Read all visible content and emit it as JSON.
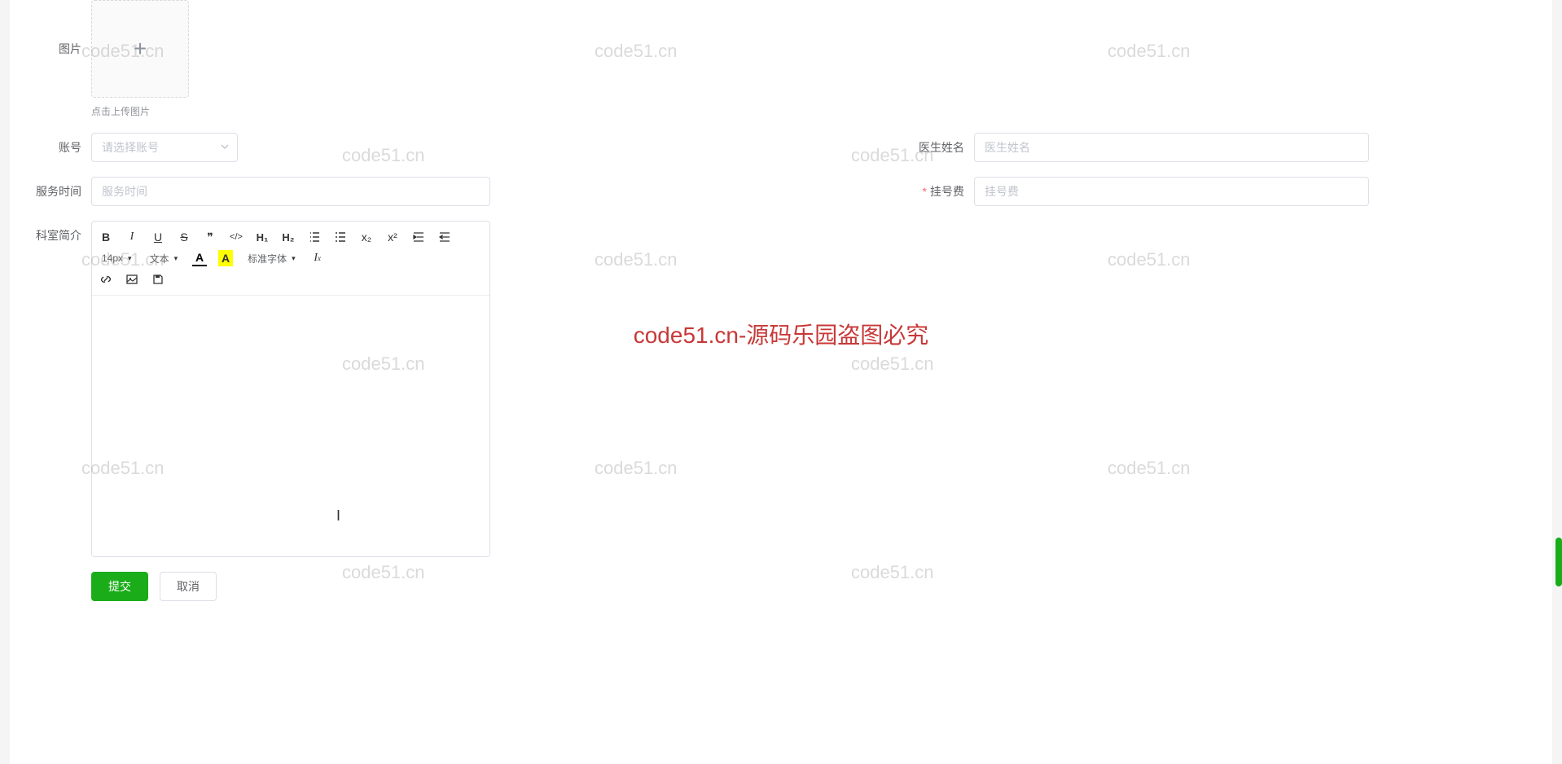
{
  "labels": {
    "image": "图片",
    "upload_hint": "点击上传图片",
    "account": "账号",
    "doctor_name": "医生姓名",
    "service_time": "服务时间",
    "registration_fee": "挂号费",
    "department_intro": "科室简介"
  },
  "placeholders": {
    "account": "请选择账号",
    "doctor_name": "医生姓名",
    "service_time": "服务时间",
    "registration_fee": "挂号费"
  },
  "editor": {
    "font_size": "14px",
    "text_style": "文本",
    "font_family": "标准字体",
    "btn_bold": "B",
    "btn_italic": "I",
    "btn_underline": "U",
    "btn_strike": "S",
    "btn_quote": "❞",
    "btn_code": "</>",
    "btn_h1": "H₁",
    "btn_h2": "H₂",
    "btn_sub": "x₂",
    "btn_sup": "x²",
    "btn_color_text": "A",
    "btn_color_bg": "A"
  },
  "buttons": {
    "submit": "提交",
    "cancel": "取消"
  },
  "watermark": {
    "text": "code51.cn",
    "center": "code51.cn-源码乐园盗图必究"
  }
}
